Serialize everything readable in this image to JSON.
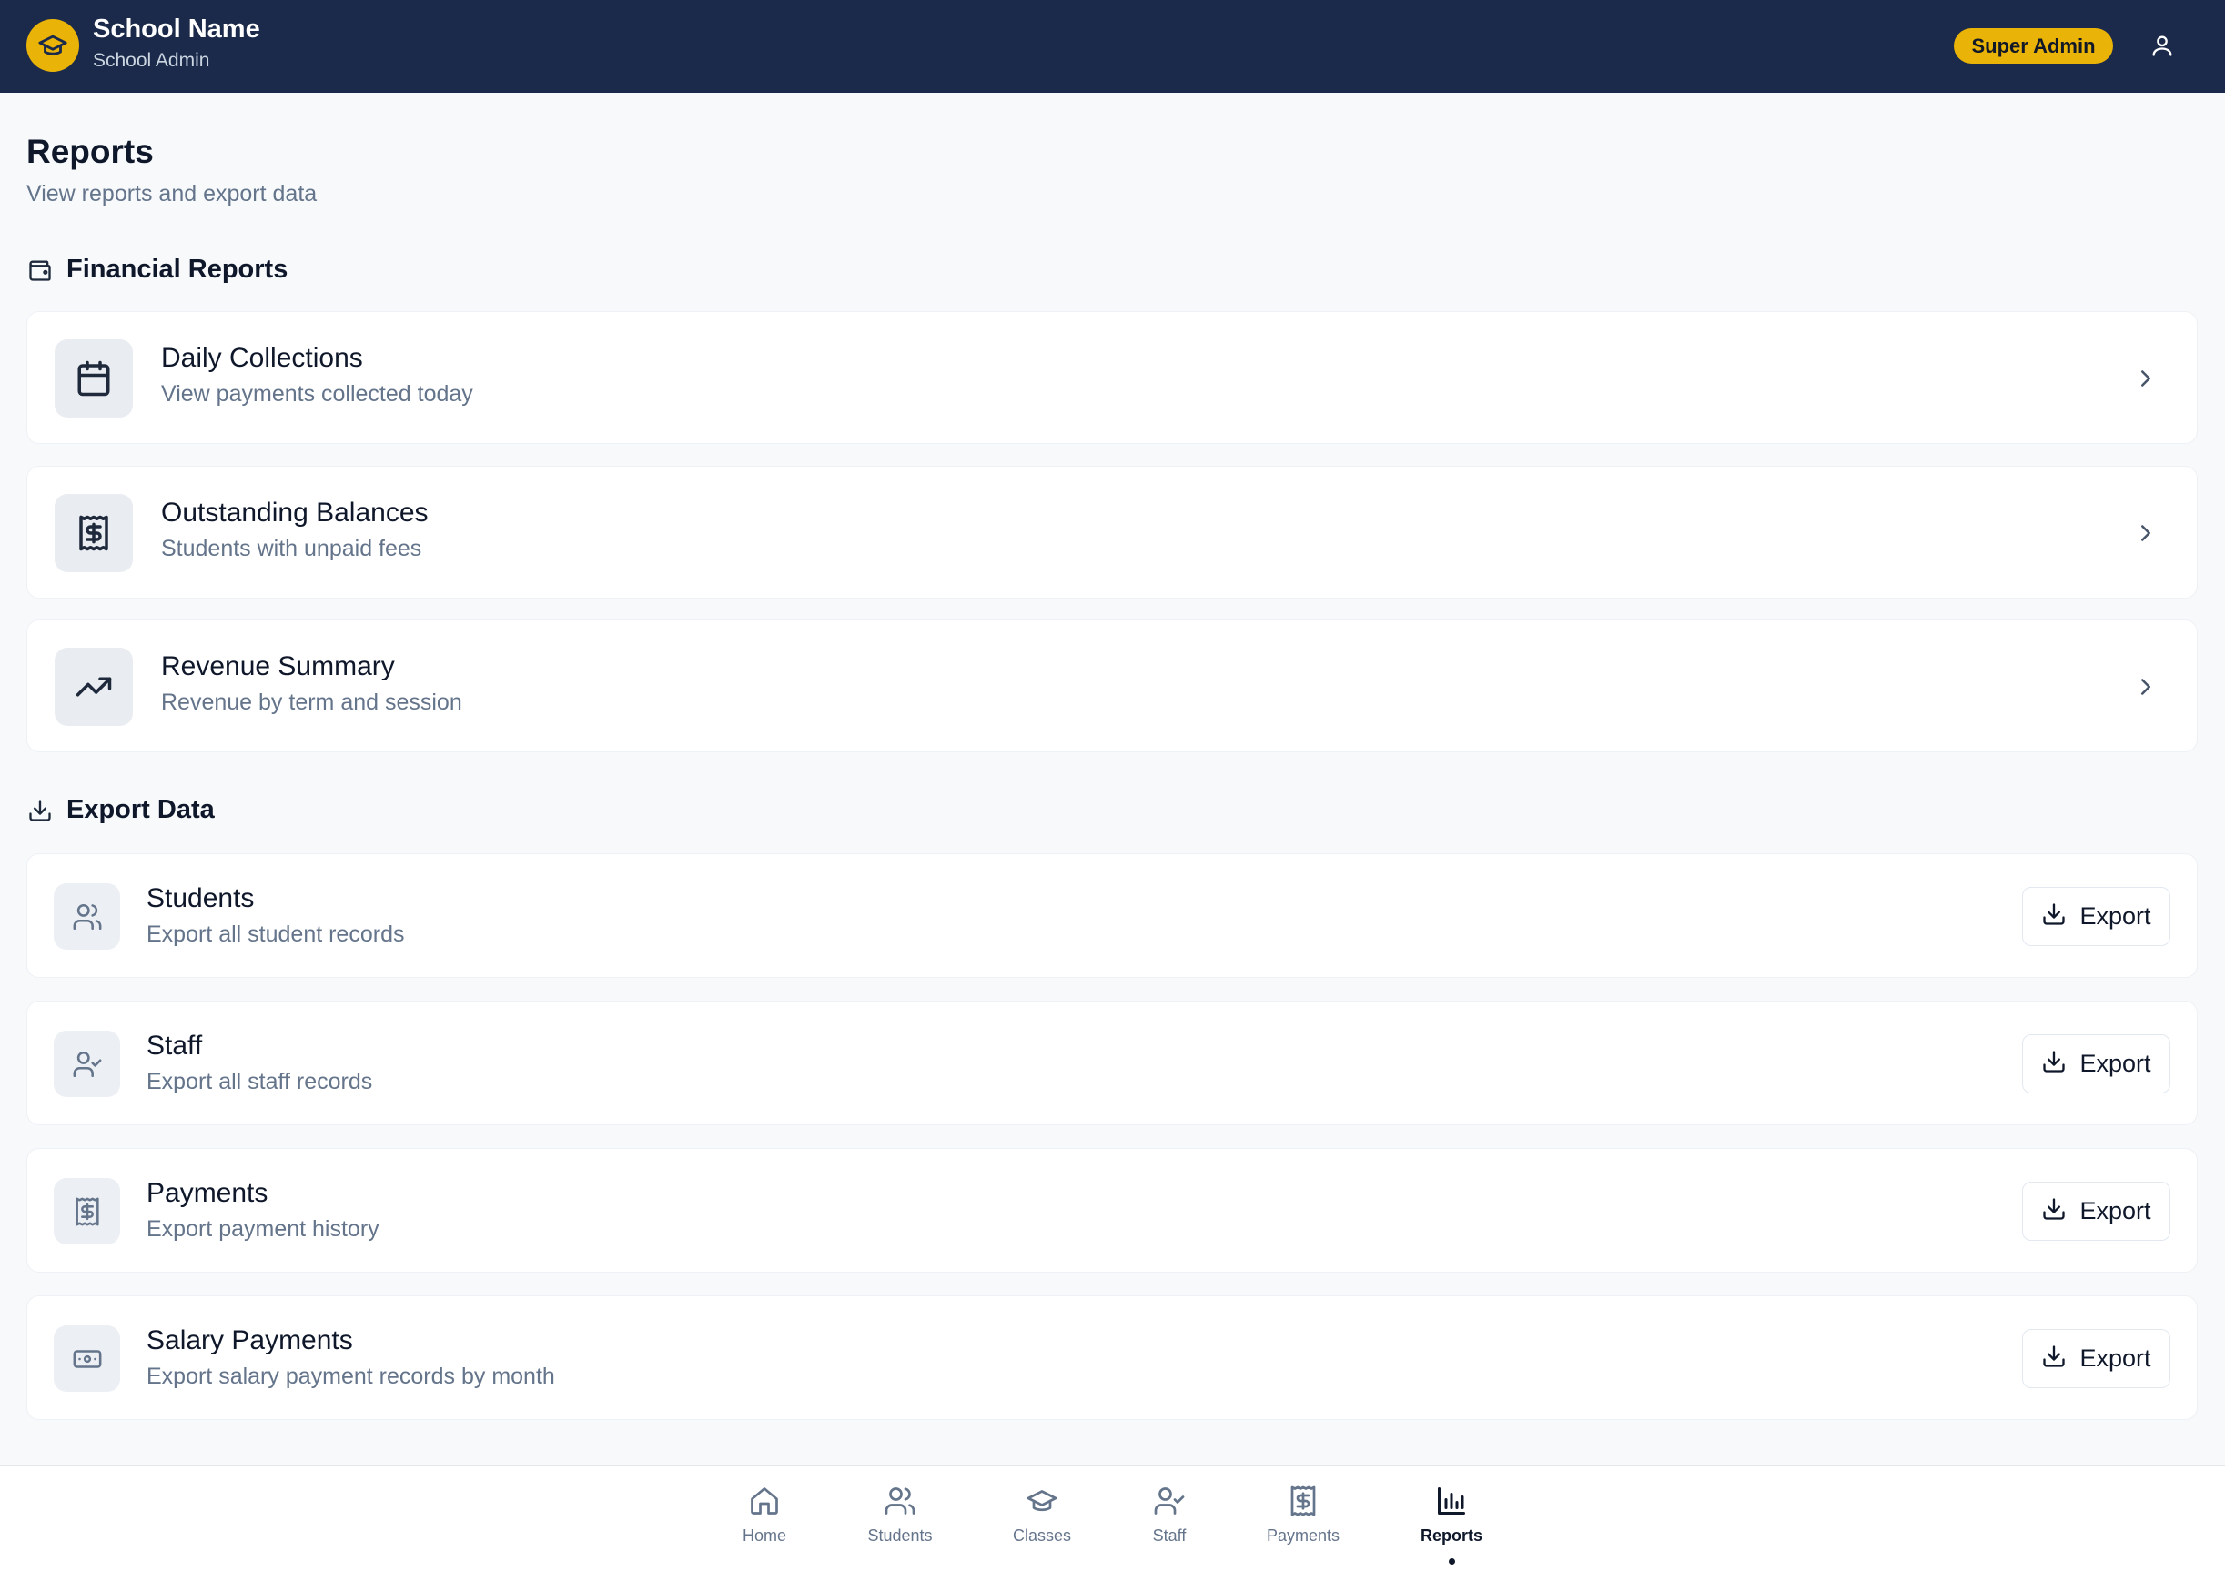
{
  "header": {
    "school_name": "School Name",
    "school_role": "School Admin",
    "badge": "Super Admin",
    "logo_icon": "graduation-cap-icon",
    "user_icon": "user-icon",
    "colors": {
      "background": "#1b2a4a",
      "accent": "#eab308"
    }
  },
  "page": {
    "title": "Reports",
    "subtitle": "View reports and export data"
  },
  "financial": {
    "heading": "Financial Reports",
    "heading_icon": "wallet-icon",
    "items": [
      {
        "title": "Daily Collections",
        "desc": "View payments collected today",
        "icon": "calendar-icon"
      },
      {
        "title": "Outstanding Balances",
        "desc": "Students with unpaid fees",
        "icon": "receipt-icon"
      },
      {
        "title": "Revenue Summary",
        "desc": "Revenue by term and session",
        "icon": "trending-up-icon"
      }
    ]
  },
  "export": {
    "heading": "Export Data",
    "heading_icon": "download-icon",
    "items": [
      {
        "title": "Students",
        "desc": "Export all student records",
        "button": "Export",
        "icon": "users-icon"
      },
      {
        "title": "Staff",
        "desc": "Export all staff records",
        "button": "Export",
        "icon": "user-check-icon"
      },
      {
        "title": "Payments",
        "desc": "Export payment history",
        "button": "Export",
        "icon": "receipt-icon"
      },
      {
        "title": "Salary Payments",
        "desc": "Export salary payment records by month",
        "button": "Export",
        "icon": "banknote-icon"
      }
    ]
  },
  "nav": {
    "items": [
      {
        "label": "Home",
        "icon": "home-icon"
      },
      {
        "label": "Students",
        "icon": "users-icon"
      },
      {
        "label": "Classes",
        "icon": "graduation-cap-icon"
      },
      {
        "label": "Staff",
        "icon": "user-check-icon"
      },
      {
        "label": "Payments",
        "icon": "receipt-icon"
      },
      {
        "label": "Reports",
        "icon": "bar-chart-icon",
        "active": true
      }
    ]
  }
}
